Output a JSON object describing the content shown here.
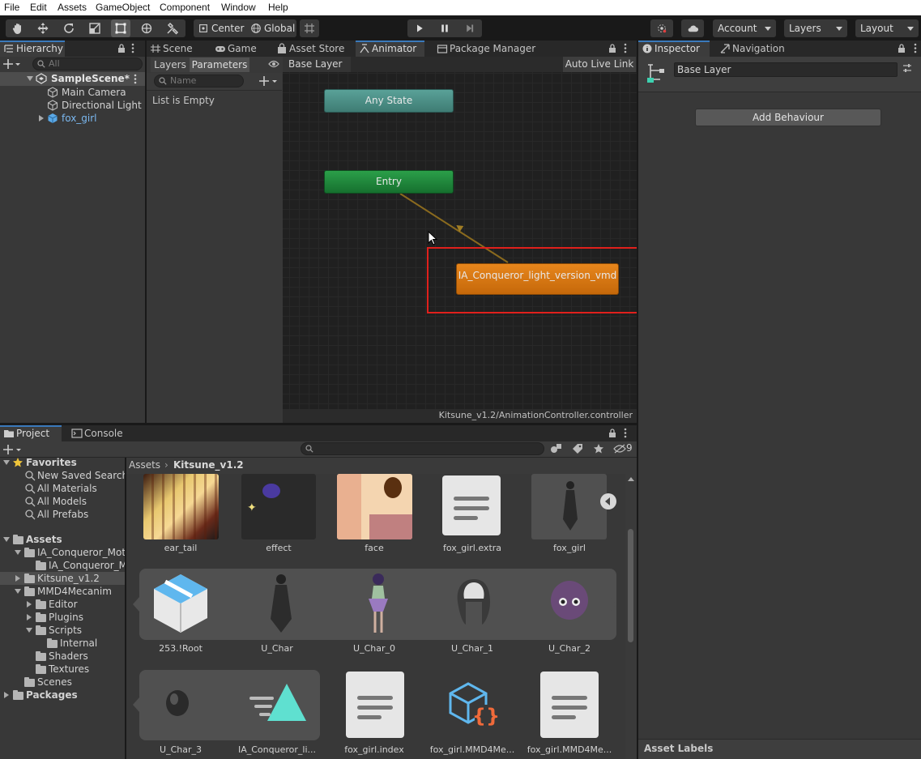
{
  "menubar": {
    "items": [
      "File",
      "Edit",
      "Assets",
      "GameObject",
      "Component",
      "Window",
      "Help"
    ]
  },
  "toolbar": {
    "pivot_label": "Center",
    "space_label": "Global",
    "account_label": "Account",
    "layers_label": "Layers",
    "layout_label": "Layout"
  },
  "hierarchy": {
    "tab_label": "Hierarchy",
    "search_placeholder": "All",
    "scene_name": "SampleScene*",
    "items": [
      "Main Camera",
      "Directional Light",
      "fox_girl"
    ]
  },
  "center_tabs": {
    "scene": "Scene",
    "game": "Game",
    "asset_store": "Asset Store",
    "animator": "Animator",
    "package_manager": "Package Manager"
  },
  "animator": {
    "layers_tab": "Layers",
    "parameters_tab": "Parameters",
    "breadcrumb": "Base Layer",
    "auto_live_link": "Auto Live Link",
    "name_placeholder": "Name",
    "list_empty": "List is Empty",
    "nodes": {
      "any_state": "Any State",
      "entry": "Entry",
      "state": "IA_Conqueror_light_version_vmd"
    },
    "footer_path": "Kitsune_v1.2/AnimationController.controller"
  },
  "inspector": {
    "tab_label": "Inspector",
    "nav_tab_label": "Navigation",
    "layer_name": "Base Layer",
    "add_behaviour": "Add Behaviour",
    "asset_labels": "Asset Labels"
  },
  "project": {
    "tab_label": "Project",
    "console_label": "Console",
    "hidden_count": "9",
    "breadcrumb_root": "Assets",
    "breadcrumb_current": "Kitsune_v1.2",
    "favorites_label": "Favorites",
    "favorites": [
      "New Saved Search",
      "All Materials",
      "All Models",
      "All Prefabs"
    ],
    "assets_label": "Assets",
    "tree": {
      "ia_folder": "IA_Conqueror_Motio",
      "ia_sub": "IA_Conqueror_Mo",
      "kitsune": "Kitsune_v1.2",
      "mmd": "MMD4Mecanim",
      "editor": "Editor",
      "plugins": "Plugins",
      "scripts": "Scripts",
      "internal": "Internal",
      "shaders": "Shaders",
      "textures": "Textures",
      "scenes": "Scenes",
      "packages": "Packages"
    },
    "assets": {
      "row1": [
        "ear_tail",
        "effect",
        "face",
        "fox_girl.extra",
        "fox_girl"
      ],
      "row2": [
        "253.!Root",
        "U_Char",
        "U_Char_0",
        "U_Char_1",
        "U_Char_2"
      ],
      "row3": [
        "U_Char_3",
        "IA_Conqueror_li...",
        "fox_girl.index",
        "fox_girl.MMD4Me...",
        "fox_girl.MMD4Me..."
      ]
    }
  },
  "colors": {
    "accent": "#3a79bb",
    "any_state_node": "#4f9188",
    "entry_node": "#1f8a3c",
    "state_node": "#d9770d",
    "highlight_box": "#e0201c",
    "transition": "#8a6a1e"
  }
}
